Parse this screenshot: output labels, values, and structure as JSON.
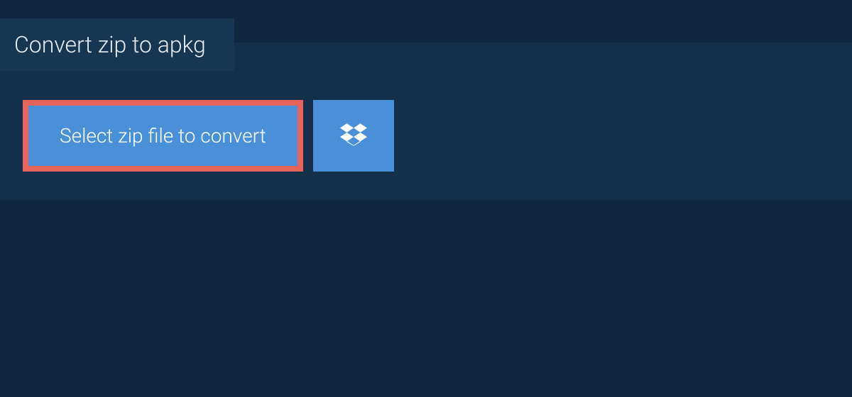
{
  "tab": {
    "label": "Convert zip to apkg"
  },
  "buttons": {
    "select_label": "Select zip file to convert"
  },
  "colors": {
    "background_outer": "#0f2840",
    "background_panel": "#132f4a",
    "background_tab": "#163651",
    "button_primary": "#4a90d9",
    "button_border_highlight": "#e6645a",
    "text_light": "#e8edf2"
  }
}
